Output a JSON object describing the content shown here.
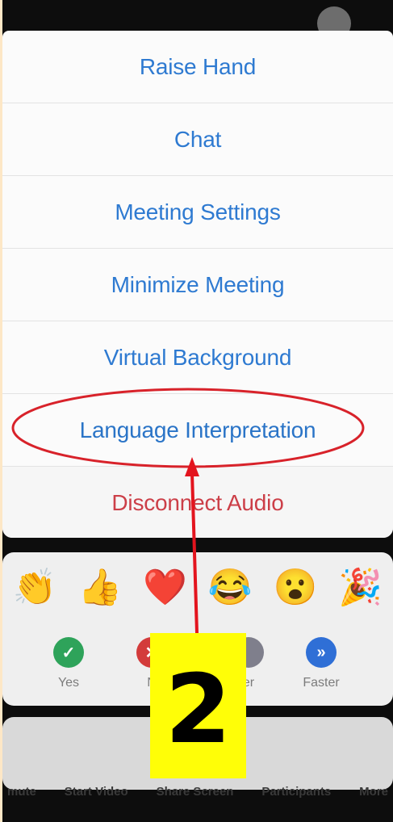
{
  "menu": {
    "items": [
      {
        "label": "Raise Hand"
      },
      {
        "label": "Chat"
      },
      {
        "label": "Meeting Settings"
      },
      {
        "label": "Minimize Meeting"
      },
      {
        "label": "Virtual Background"
      },
      {
        "label": "Language Interpretation"
      },
      {
        "label": "Disconnect Audio"
      }
    ]
  },
  "reactions": {
    "emojis": [
      {
        "name": "clapping-hands",
        "glyph": "👏"
      },
      {
        "name": "thumbs-up",
        "glyph": "👍"
      },
      {
        "name": "red-heart",
        "glyph": "❤️"
      },
      {
        "name": "tears-of-joy",
        "glyph": "😂"
      },
      {
        "name": "surprised-face",
        "glyph": "😮"
      },
      {
        "name": "party-popper",
        "glyph": "🎉"
      }
    ],
    "feedback": [
      {
        "label": "Yes",
        "symbol": "✓",
        "color": "#2ea35a"
      },
      {
        "label": "N",
        "symbol": "✕",
        "color": "#d33b3b"
      },
      {
        "label": "er",
        "symbol": "",
        "color": "#7f7f8c"
      },
      {
        "label": "Faster",
        "symbol": "»",
        "color": "#2f6fd6"
      }
    ]
  },
  "toolbar": {
    "items": [
      "mute",
      "Start Video",
      "Share Screen",
      "Participants",
      "More"
    ]
  },
  "annotation": {
    "step_number": "2",
    "highlight_color": "#d8222a",
    "badge_color": "#fffe07"
  }
}
